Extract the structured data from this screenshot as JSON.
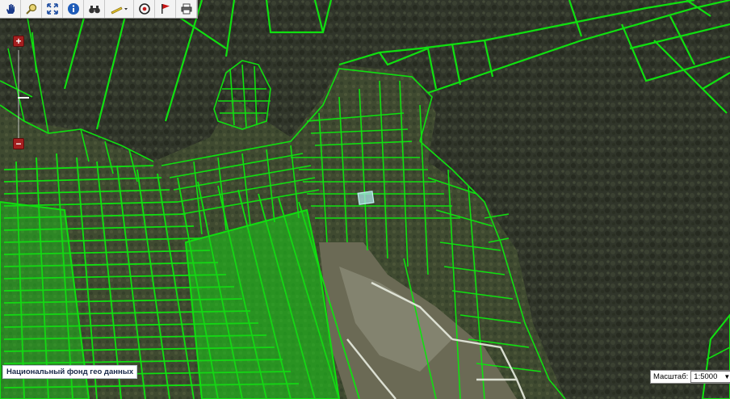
{
  "toolbar": {
    "icons": [
      "hand-pan-icon",
      "zoom-magnifier-icon",
      "full-extent-icon",
      "info-icon",
      "binoculars-icon",
      "ruler-measure-icon",
      "target-icon",
      "flag-icon",
      "printer-icon"
    ]
  },
  "zoom": {
    "plus_label": "+",
    "minus_label": "−"
  },
  "attribution": {
    "text": "Национальный фонд гео данных"
  },
  "scale": {
    "label": "Масштаб:",
    "value": "1:5000"
  },
  "colors": {
    "parcel_line": "#10e010",
    "highlight_parcel": "#a8e6e6",
    "forest_dark": "#2d3224",
    "forest_mid": "#3b4030",
    "toolbar_bg": "#f3f3f3",
    "zoom_button": "#a41f1f"
  }
}
